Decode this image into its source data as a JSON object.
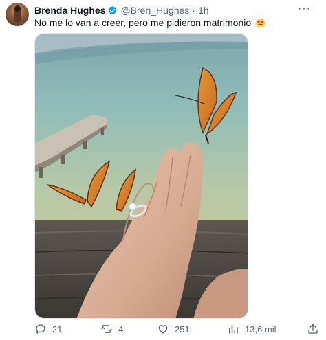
{
  "author": {
    "name": "Brenda Hughes",
    "handle": "@Bren_Hughes",
    "separator": "·",
    "time": "1h"
  },
  "tweet": {
    "text": "No me lo van a creer, pero me pidieron matrimonio",
    "emoji": "heart-eyes-emoji"
  },
  "menu": {
    "more_label": "···"
  },
  "metrics": {
    "replies": "21",
    "retweets": "4",
    "likes": "251",
    "views": "13,6 mil"
  },
  "icons": {
    "reply": "reply-icon",
    "retweet": "retweet-icon",
    "like": "heart-icon",
    "views": "views-chart-icon",
    "share": "share-icon",
    "verified": "verified-badge-icon"
  },
  "colors": {
    "text_primary": "#0f1419",
    "text_secondary": "#536471",
    "verified_blue": "#1d9bf0"
  }
}
